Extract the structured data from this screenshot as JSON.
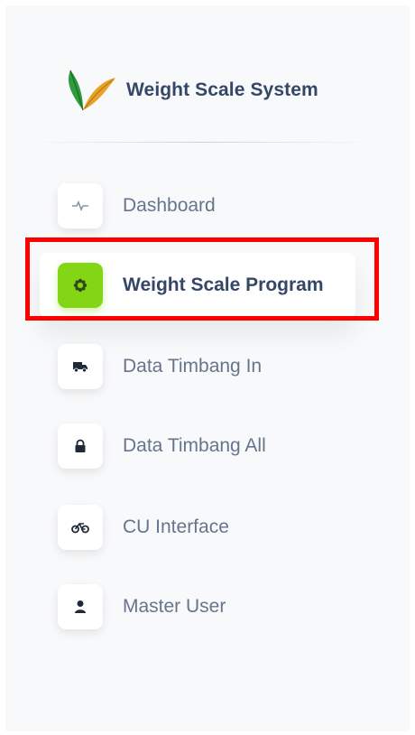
{
  "brand": {
    "title": "Weight Scale System",
    "logo_icon": "leaf-logo-icon"
  },
  "sidebar": {
    "items": [
      {
        "label": "Dashboard",
        "icon": "pulse-icon",
        "active": false
      },
      {
        "label": "Weight Scale Program",
        "icon": "gear-flower-icon",
        "active": true
      },
      {
        "label": "Data Timbang In",
        "icon": "truck-icon",
        "active": false
      },
      {
        "label": "Data Timbang All",
        "icon": "lock-icon",
        "active": false
      },
      {
        "label": "CU Interface",
        "icon": "bicycle-icon",
        "active": false
      },
      {
        "label": "Master User",
        "icon": "user-icon",
        "active": false
      }
    ]
  },
  "colors": {
    "accent": "#82d616",
    "text_active": "#344767",
    "text": "#67748e",
    "highlight": "#ff0000"
  }
}
